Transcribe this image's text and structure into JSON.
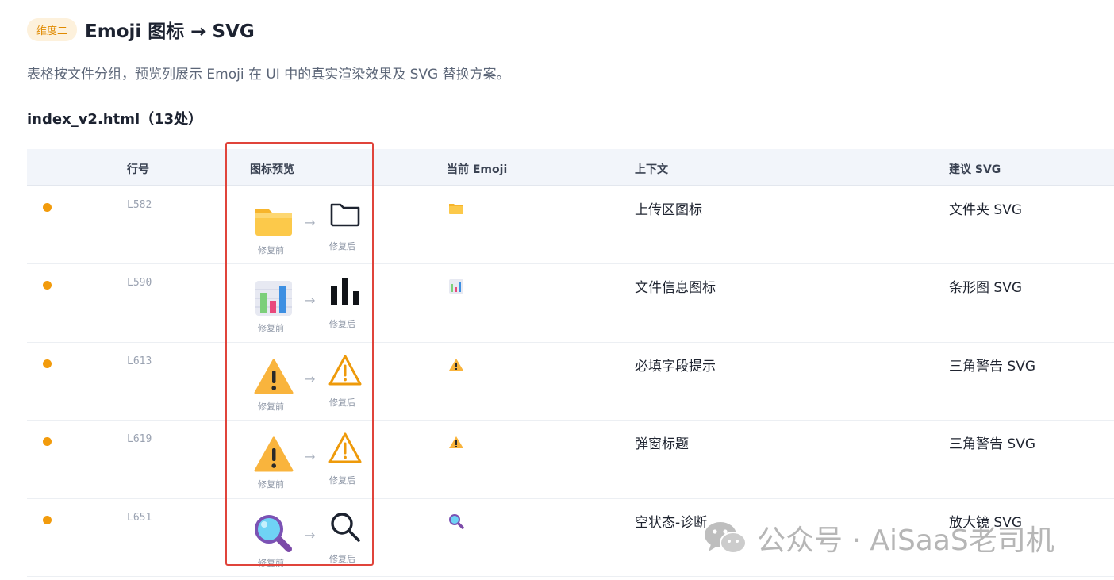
{
  "header": {
    "badge": "维度二",
    "title": "Emoji 图标 → SVG"
  },
  "description": "表格按文件分组，预览列展示 Emoji 在 UI 中的真实渲染效果及 SVG 替换方案。",
  "section_title": "index_v2.html（13处）",
  "columns": {
    "line": "行号",
    "preview": "图标预览",
    "emoji": "当前 Emoji",
    "context": "上下文",
    "svg": "建议 SVG"
  },
  "captions": {
    "before": "修复前",
    "after": "修复后",
    "arrow": "→"
  },
  "rows": [
    {
      "line": "L582",
      "context": "上传区图标",
      "svg": "文件夹 SVG",
      "icon": "folder-icon"
    },
    {
      "line": "L590",
      "context": "文件信息图标",
      "svg": "条形图 SVG",
      "icon": "bar-chart-icon"
    },
    {
      "line": "L613",
      "context": "必填字段提示",
      "svg": "三角警告 SVG",
      "icon": "warning-icon"
    },
    {
      "line": "L619",
      "context": "弹窗标题",
      "svg": "三角警告 SVG",
      "icon": "warning-icon"
    },
    {
      "line": "L651",
      "context": "空状态-诊断",
      "svg": "放大镜 SVG",
      "icon": "magnifier-icon"
    }
  ],
  "watermark": "公众号 · AiSaaS老司机",
  "colors": {
    "accent_orange": "#f29b0c",
    "highlight_red": "#e0443b",
    "badge_bg": "#fdf1dc"
  }
}
